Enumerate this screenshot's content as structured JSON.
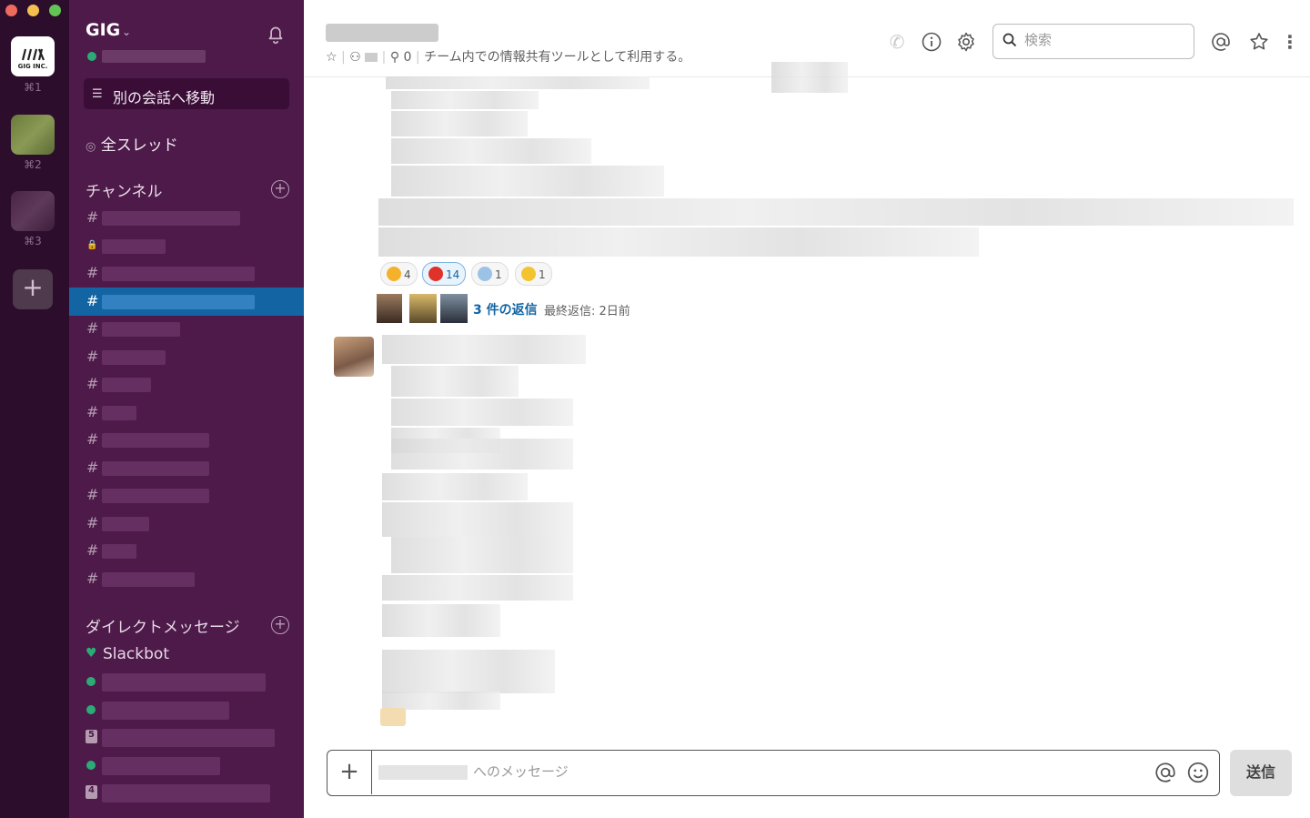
{
  "teams": {
    "items": [
      {
        "logo_text": "GIG INC.",
        "shortcut": "⌘1"
      },
      {
        "shortcut": "⌘2"
      },
      {
        "shortcut": "⌘3"
      }
    ],
    "add_label": "+"
  },
  "sidebar": {
    "workspace_name": "GIG",
    "workspace_caret": "⌄",
    "jump_label": "別の会話へ移動",
    "threads_label": "全スレッド",
    "channels_header": "チャンネル",
    "channel_count": 14,
    "active_channel_index": 3,
    "dm_header": "ダイレクトメッセージ",
    "slackbot_label": "Slackbot",
    "dm_badges": [
      "5",
      "4"
    ]
  },
  "header": {
    "member_count": "—",
    "pin_count": "0",
    "topic": "チーム内での情報共有ツールとして利用する。"
  },
  "search": {
    "placeholder": "検索"
  },
  "messages": {
    "reactions": [
      {
        "emoji": "thumbs-up",
        "count": "4"
      },
      {
        "emoji": "celebrate-kanji",
        "count": "14"
      },
      {
        "emoji": "screaming-face",
        "count": "1"
      },
      {
        "emoji": "joy-face",
        "count": "1"
      }
    ],
    "replies_label": "3 件の返信",
    "last_reply_label": "最終返信: 2日前"
  },
  "composer": {
    "placeholder": "へのメッセージ",
    "send_label": "送信"
  },
  "colors": {
    "sidebar": "#4d1a4a",
    "teams": "#2c0d2c",
    "active": "#1264a3",
    "online": "#2bac76"
  }
}
